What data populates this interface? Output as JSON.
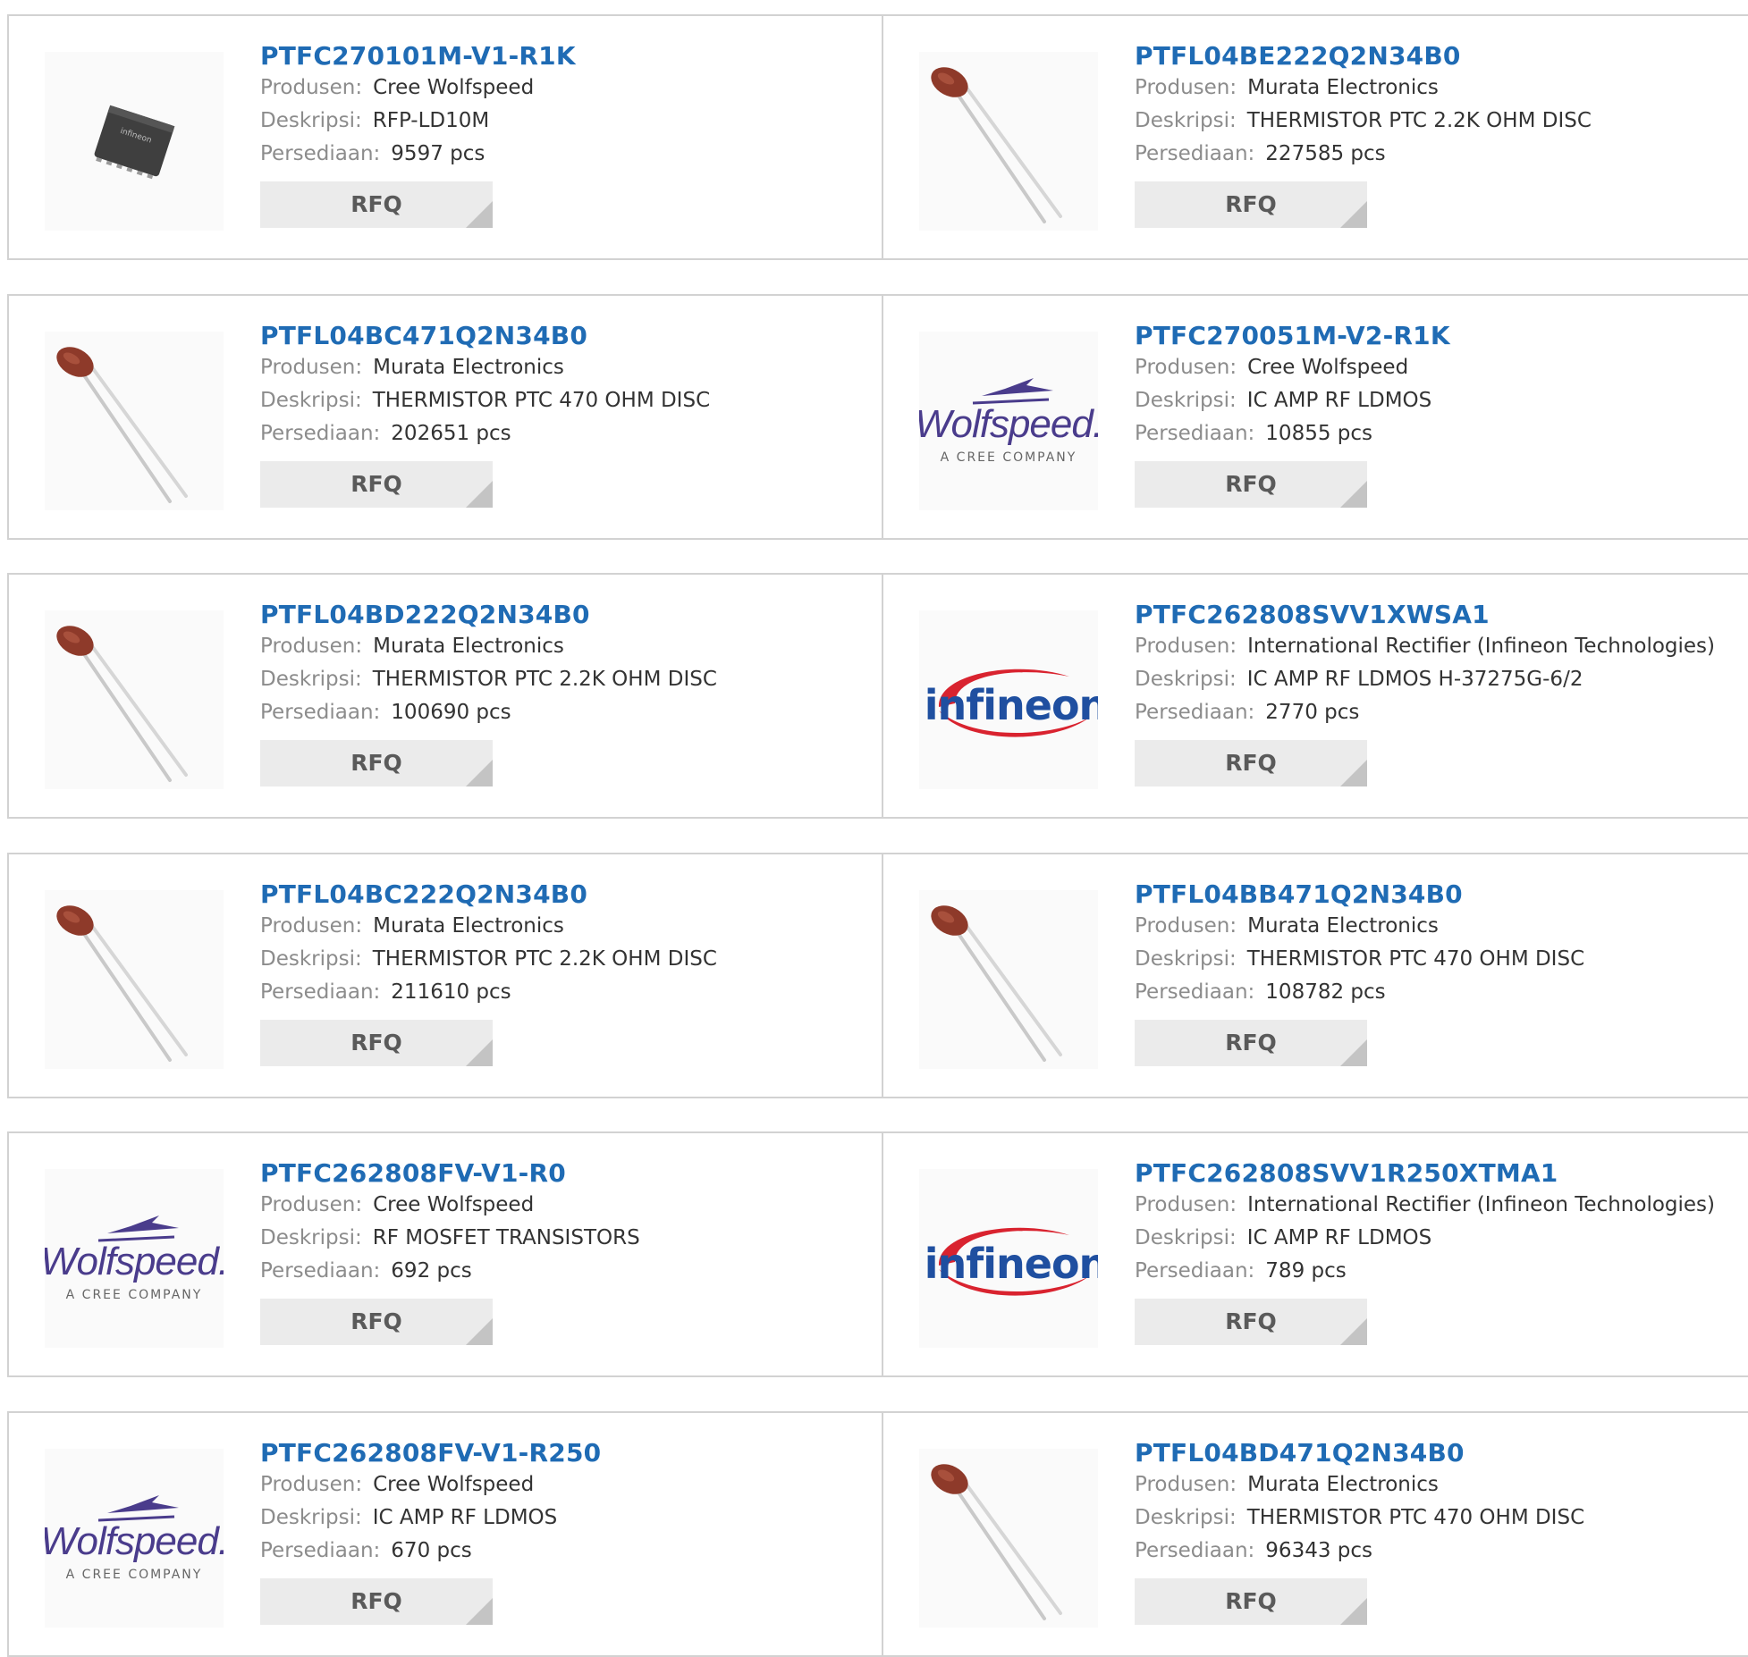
{
  "labels": {
    "manufacturer": "Produsen:",
    "description": "Deskripsi:",
    "stock": "Persediaan:",
    "rfq": "RFQ"
  },
  "products": [
    {
      "part": "PTFC270101M-V1-R1K",
      "manufacturer": "Cree Wolfspeed",
      "description": "RFP-LD10M",
      "stock": "9597 pcs",
      "image": "chip-icon"
    },
    {
      "part": "PTFL04BE222Q2N34B0",
      "manufacturer": "Murata Electronics",
      "description": "THERMISTOR PTC 2.2K OHM DISC",
      "stock": "227585 pcs",
      "image": "thermistor-icon"
    },
    {
      "part": "PTFL04BC471Q2N34B0",
      "manufacturer": "Murata Electronics",
      "description": "THERMISTOR PTC 470 OHM DISC",
      "stock": "202651 pcs",
      "image": "thermistor-icon"
    },
    {
      "part": "PTFC270051M-V2-R1K",
      "manufacturer": "Cree Wolfspeed",
      "description": "IC AMP RF LDMOS",
      "stock": "10855 pcs",
      "image": "wolfspeed-logo"
    },
    {
      "part": "PTFL04BD222Q2N34B0",
      "manufacturer": "Murata Electronics",
      "description": "THERMISTOR PTC 2.2K OHM DISC",
      "stock": "100690 pcs",
      "image": "thermistor-icon"
    },
    {
      "part": "PTFC262808SVV1XWSA1",
      "manufacturer": "International Rectifier (Infineon Technologies)",
      "description": "IC AMP RF LDMOS H-37275G-6/2",
      "stock": "2770 pcs",
      "image": "infineon-logo"
    },
    {
      "part": "PTFL04BC222Q2N34B0",
      "manufacturer": "Murata Electronics",
      "description": "THERMISTOR PTC 2.2K OHM DISC",
      "stock": "211610 pcs",
      "image": "thermistor-icon"
    },
    {
      "part": "PTFL04BB471Q2N34B0",
      "manufacturer": "Murata Electronics",
      "description": "THERMISTOR PTC 470 OHM DISC",
      "stock": "108782 pcs",
      "image": "thermistor-icon"
    },
    {
      "part": "PTFC262808FV-V1-R0",
      "manufacturer": "Cree Wolfspeed",
      "description": "RF MOSFET TRANSISTORS",
      "stock": "692 pcs",
      "image": "wolfspeed-logo"
    },
    {
      "part": "PTFC262808SVV1R250XTMA1",
      "manufacturer": "International Rectifier (Infineon Technologies)",
      "description": "IC AMP RF LDMOS",
      "stock": "789 pcs",
      "image": "infineon-logo"
    },
    {
      "part": "PTFC262808FV-V1-R250",
      "manufacturer": "Cree Wolfspeed",
      "description": "IC AMP RF LDMOS",
      "stock": "670 pcs",
      "image": "wolfspeed-logo"
    },
    {
      "part": "PTFL04BD471Q2N34B0",
      "manufacturer": "Murata Electronics",
      "description": "THERMISTOR PTC 470 OHM DISC",
      "stock": "96343 pcs",
      "image": "thermistor-icon"
    }
  ],
  "logos": {
    "wolfspeed": {
      "name": "Wolfspeed.",
      "tagline": "A CREE COMPANY",
      "color": "#4a3c8c"
    },
    "infineon": {
      "name": "infineon",
      "color": "#1f4fa0",
      "swoosh": "#d9232f"
    },
    "chip": {
      "text": "infineon"
    }
  },
  "colors": {
    "link": "#1f6bb4",
    "label": "#8c8c8c",
    "value": "#333333",
    "button_bg": "#ebebeb",
    "border": "#d2d2d2"
  }
}
